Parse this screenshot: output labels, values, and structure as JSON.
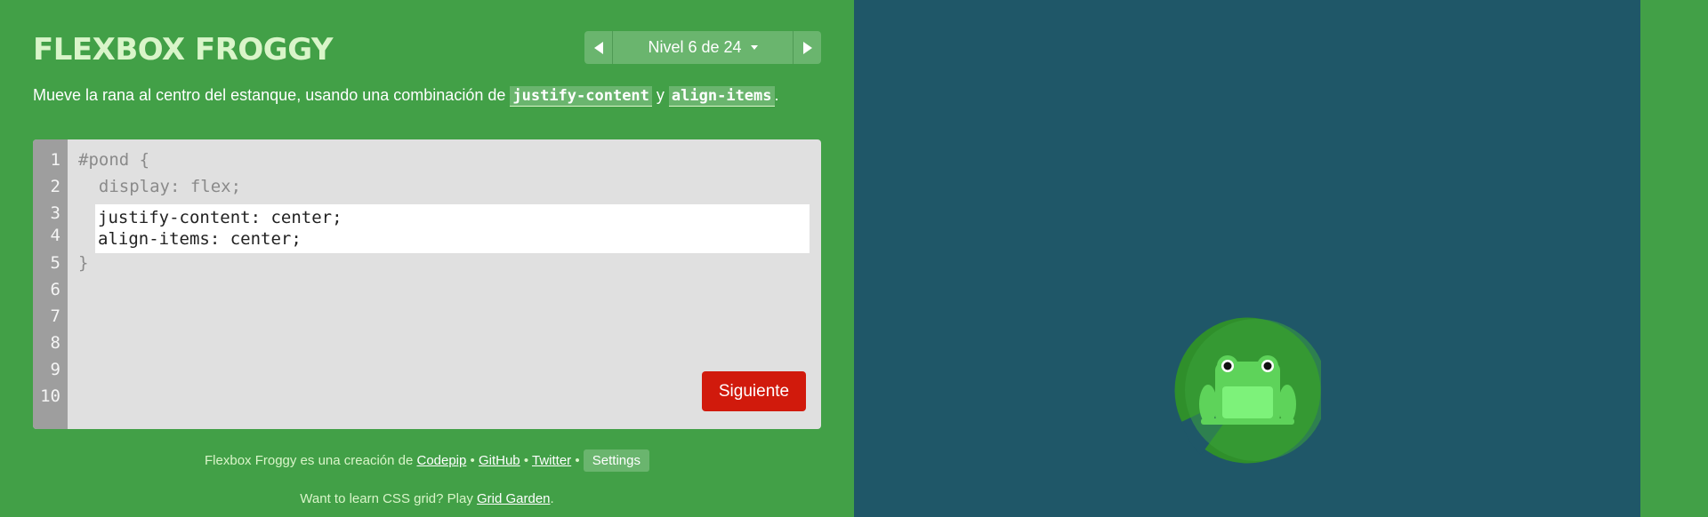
{
  "app": {
    "title": "FLEXBOX FROGGY"
  },
  "level_nav": {
    "label": "Nivel 6 de 24",
    "prev_icon": "triangle-left-icon",
    "next_icon": "triangle-right-icon",
    "dropdown_icon": "caret-down-icon"
  },
  "instructions": {
    "prefix": "Mueve la rana al centro del estanque, usando una combinación de ",
    "code1": "justify-content",
    "middle": " y ",
    "code2": "align-items",
    "suffix": "."
  },
  "editor": {
    "line_numbers": [
      "1",
      "2",
      "3",
      "4",
      "5",
      "6",
      "7",
      "8",
      "9",
      "10"
    ],
    "line1": "#pond {",
    "line2": "  display: flex;",
    "input_line1": "justify-content: center;",
    "input_line2": "align-items: center;",
    "line5": "}",
    "submit_label": "Siguiente"
  },
  "footer": {
    "credit_prefix": "Flexbox Froggy es una creación de ",
    "link_codepip": "Codepip",
    "sep1": " • ",
    "link_github": "GitHub",
    "sep2": " • ",
    "link_twitter": "Twitter",
    "sep3": " • ",
    "settings_label": "Settings",
    "grid_prefix": "Want to learn CSS grid? Play ",
    "link_grid_garden": "Grid Garden",
    "grid_suffix": "."
  },
  "colors": {
    "background_green": "#42a047",
    "pond_blue": "#1f5768",
    "lilypad_green": "#2f8f2b",
    "frog_green": "#5ed35a",
    "next_button_red": "#d11a0c"
  }
}
